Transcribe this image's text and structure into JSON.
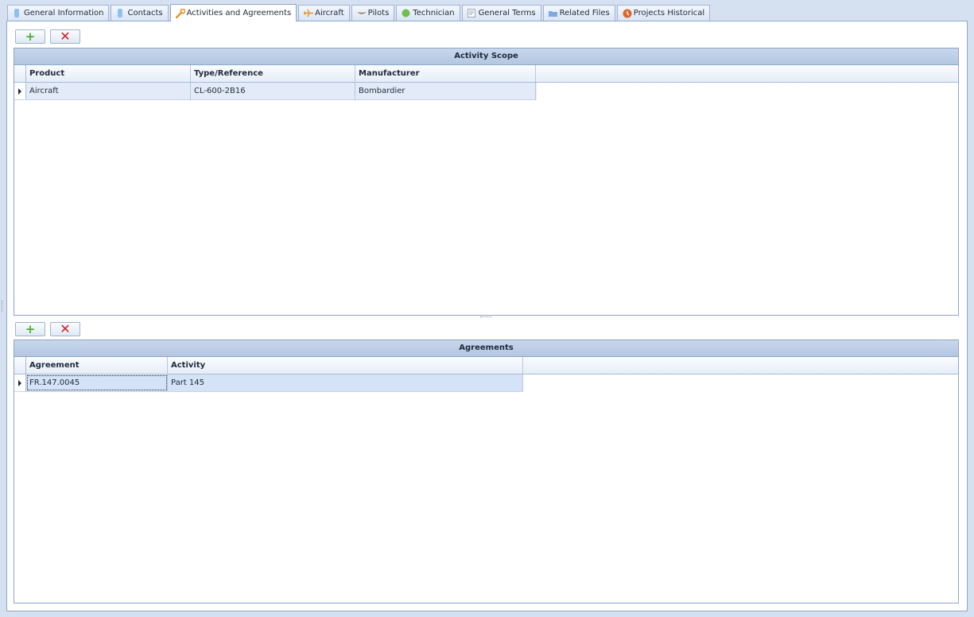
{
  "tabs": [
    {
      "label": "General Information",
      "icon": "info-icon"
    },
    {
      "label": "Contacts",
      "icon": "contacts-icon"
    },
    {
      "label": "Activities and Agreements",
      "icon": "wrench-icon"
    },
    {
      "label": "Aircraft",
      "icon": "airplane-icon"
    },
    {
      "label": "Pilots",
      "icon": "pilot-wings-icon"
    },
    {
      "label": "Technician",
      "icon": "technician-icon"
    },
    {
      "label": "General Terms",
      "icon": "document-icon"
    },
    {
      "label": "Related Files",
      "icon": "folder-icon"
    },
    {
      "label": "Projects Historical",
      "icon": "history-icon"
    }
  ],
  "active_tab": "Activities and Agreements",
  "toolbar": {
    "add_label": "+",
    "delete_label": "✕"
  },
  "activity_scope": {
    "title": "Activity Scope",
    "columns": [
      "Product",
      "Type/Reference",
      "Manufacturer"
    ],
    "rows": [
      [
        "Aircraft",
        "CL-600-2B16",
        "Bombardier"
      ]
    ]
  },
  "agreements": {
    "title": "Agreements",
    "columns": [
      "Agreement",
      "Activity"
    ],
    "rows": [
      [
        "FR.147.0045",
        "Part 145"
      ]
    ]
  },
  "colors": {
    "accent": "#b4c7e2",
    "add": "#4eae2e",
    "delete": "#d21a1a"
  }
}
